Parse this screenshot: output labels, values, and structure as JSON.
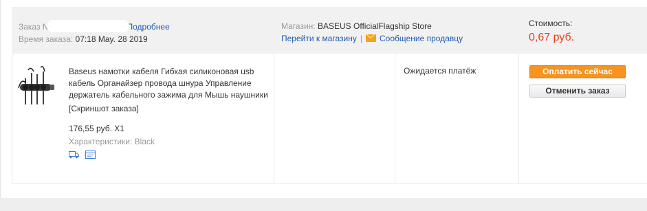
{
  "order": {
    "number_label": "Заказ N",
    "details_link": "Подробнее",
    "time_label": "Время заказа:",
    "time_value": "07:18 May. 28 2019",
    "store_label": "Магазин:",
    "store_name": "BASEUS OfficialFlagship Store",
    "go_to_store": "Перейти к магазину",
    "separator": "|",
    "message_seller": "Сообщение продавцу",
    "cost_label": "Стоимость:",
    "cost_value": "0,67 руб.",
    "accent_color": "#e43e1c"
  },
  "product": {
    "title": "Baseus намотки кабеля Гибкая силиконовая usb кабель Органайзер провода шнура Управление держатель кабельного зажима для Мышь наушники",
    "screenshot_link": "[Скриншот заказа]",
    "price": "176,55 руб. X1",
    "properties": "Характеристики: Black"
  },
  "status": {
    "text": "Ожидается платёж"
  },
  "actions": {
    "pay_now": "Оплатить сейчас",
    "cancel_order": "Отменить заказ",
    "pay_color": "#f7931e"
  },
  "icons": [
    "product-thumbnail",
    "delivery-truck-icon",
    "order-snapshot-icon",
    "mail-icon"
  ]
}
